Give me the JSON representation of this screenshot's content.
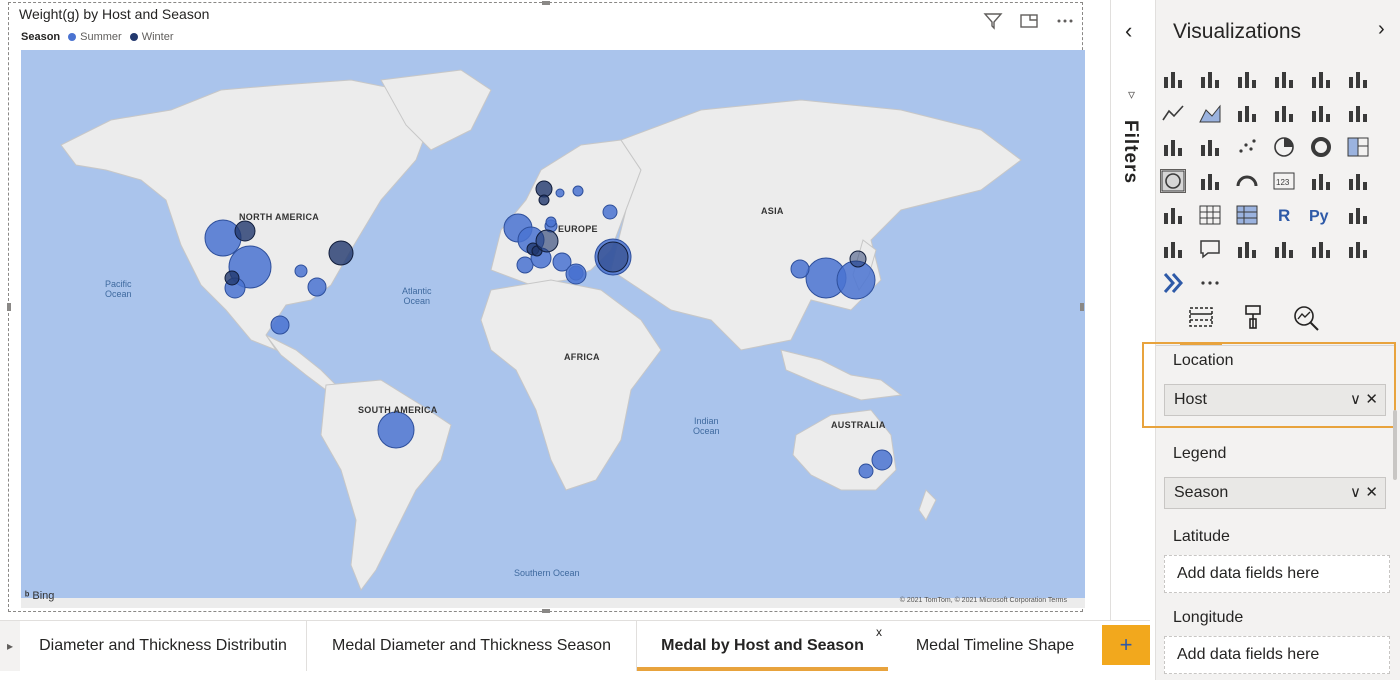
{
  "visual": {
    "title": "Weight(g) by Host and Season",
    "legend": {
      "title": "Season",
      "items": [
        {
          "label": "Summer",
          "color": "#4a73d1"
        },
        {
          "label": "Winter",
          "color": "#22386e"
        }
      ]
    },
    "icons": [
      "filter-icon",
      "focus-mode-icon",
      "more-options-icon"
    ]
  },
  "map": {
    "continents": [
      "NORTH AMERICA",
      "SOUTH AMERICA",
      "EUROPE",
      "AFRICA",
      "ASIA",
      "AUSTRALIA"
    ],
    "oceans": {
      "pacific": "Pacific\nOcean",
      "atlantic": "Atlantic\nOcean",
      "indian": "Indian\nOcean",
      "southern": "Southern Ocean"
    },
    "attribution": "Bing",
    "copyright": "© 2021 TomTom, © 2021 Microsoft Corporation  Terms"
  },
  "tabs": {
    "items": [
      {
        "label": "Diameter and Thickness Distributin",
        "active": false
      },
      {
        "label": "Medal Diameter and Thickness Season",
        "active": false
      },
      {
        "label": "Medal by Host and Season",
        "active": true
      },
      {
        "label": "Medal Timeline Shape",
        "active": false
      }
    ],
    "close_label": "x",
    "add_label": "+"
  },
  "filters": {
    "label": "Filters",
    "collapse": "‹"
  },
  "visualizations": {
    "title": "Visualizations",
    "expand": "›",
    "more": "···",
    "fields": [
      {
        "label": "Location",
        "value": "Host"
      },
      {
        "label": "Legend",
        "value": "Season"
      },
      {
        "label": "Latitude",
        "placeholder": "Add data fields here"
      },
      {
        "label": "Longitude",
        "placeholder": "Add data fields here"
      }
    ],
    "python_label": "Py",
    "r_label": "R",
    "table_label": "123"
  }
}
